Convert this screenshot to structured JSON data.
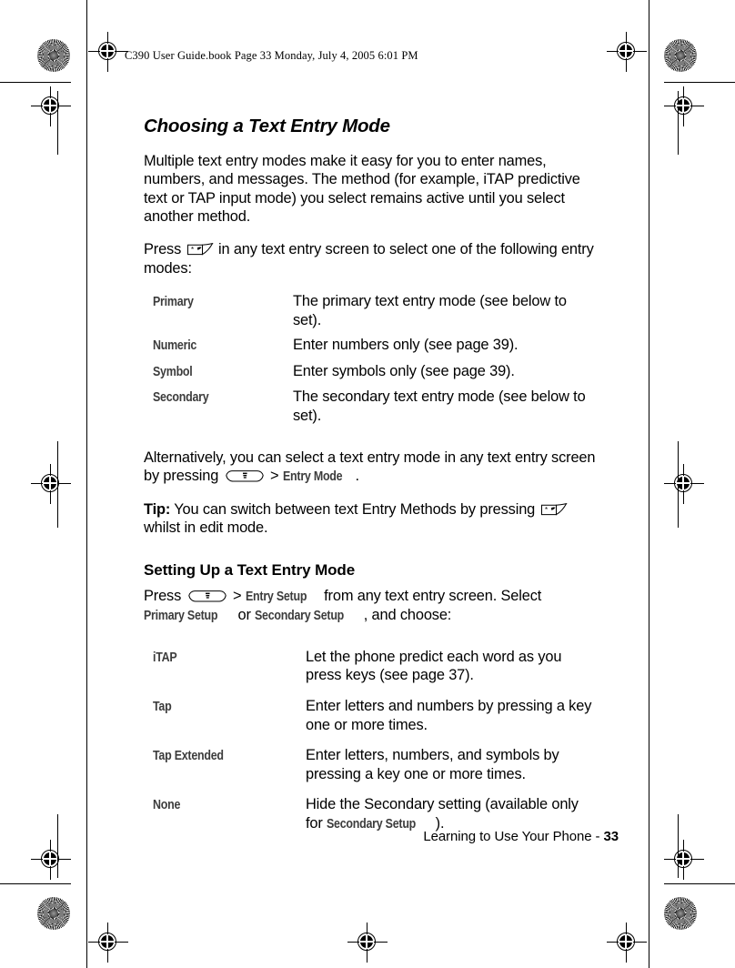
{
  "document": {
    "header_line": "C390 User Guide.book  Page 33  Monday, July 4, 2005  6:01 PM",
    "footer_text": "Learning to Use Your Phone - ",
    "footer_page": "33"
  },
  "section": {
    "title": "Choosing a Text Entry Mode",
    "intro": "Multiple text entry modes make it easy for you to enter names, numbers, and messages. The method (for example, iTAP predictive text or TAP input mode) you select remains active until you select another method.",
    "press_prefix": "Press ",
    "press_suffix": " in any text entry screen to select one of the following entry modes:",
    "modes": [
      {
        "term": "Primary",
        "desc": "The primary text entry mode (see below to set)."
      },
      {
        "term": "Numeric",
        "desc": "Enter numbers only (see page 39)."
      },
      {
        "term": "Symbol",
        "desc": "Enter symbols only (see page 39)."
      },
      {
        "term": "Secondary",
        "desc": "The secondary text entry mode (see below to set)."
      }
    ],
    "alt_prefix": "Alternatively, you can select a text entry mode in any text entry screen by pressing ",
    "alt_gt": " > ",
    "alt_menu_item": "Entry Mode",
    "alt_period": ".",
    "tip_label": "Tip:",
    "tip_text": " You can switch between text Entry Methods by pressing ",
    "tip_tail": " whilst in edit mode."
  },
  "setup": {
    "title": "Setting Up a Text Entry Mode",
    "press_word": "Press ",
    "gt": " > ",
    "menu_item": "Entry Setup",
    "mid_text": " from any text entry screen. Select ",
    "opt1": "Primary Setup",
    "or_text": " or ",
    "opt2": "Secondary Setup",
    "end_text": ", and choose:",
    "options": [
      {
        "term": "iTAP",
        "desc": "Let the phone predict each word as you press keys (see page 37)."
      },
      {
        "term": "Tap",
        "desc": "Enter letters and numbers by pressing a key one or more times."
      },
      {
        "term": "Tap Extended",
        "desc": "Enter letters, numbers, and symbols by pressing a key one or more times."
      },
      {
        "term": "None",
        "desc_before": "Hide the Secondary setting (available only for ",
        "desc_term": "Secondary Setup",
        "desc_after": ")."
      }
    ]
  },
  "icons": {
    "star_key": "star-key-icon",
    "menu_key": "menu-key-icon",
    "registration_mark": "registration-target-icon",
    "color_target": "radial-test-target-icon"
  },
  "colors": {
    "text": "#000000",
    "term": "#3c3c3c",
    "paper": "#ffffff"
  }
}
